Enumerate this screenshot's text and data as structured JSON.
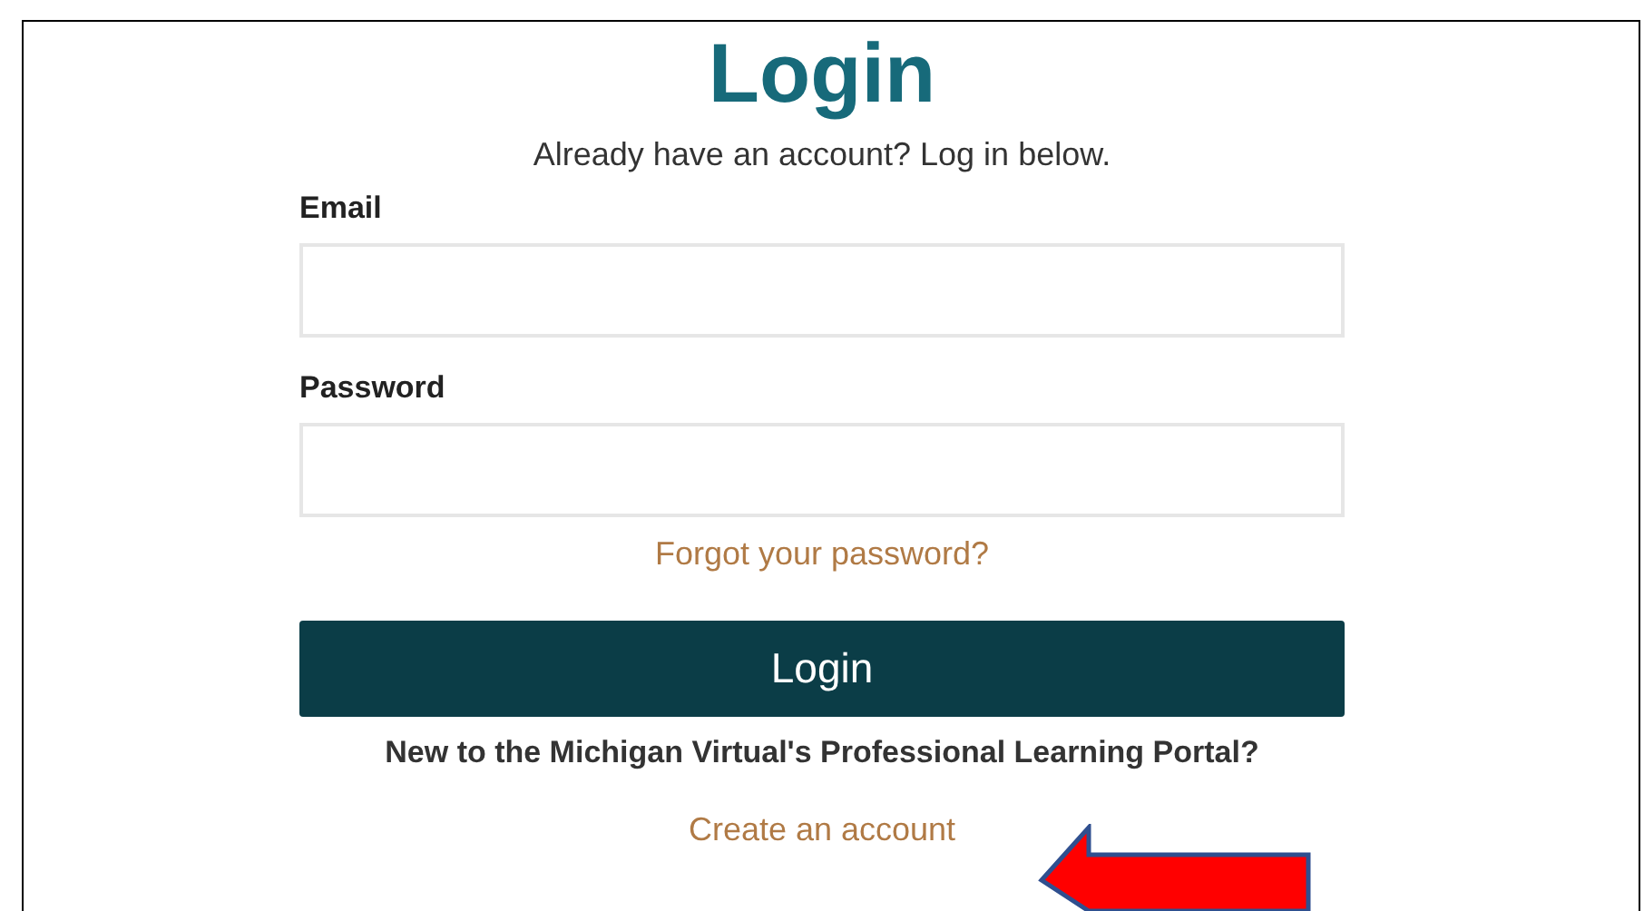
{
  "title": "Login",
  "subtitle": "Already have an account? Log in below.",
  "fields": [
    {
      "label": "Email"
    },
    {
      "label": "Password"
    }
  ],
  "forgot_link": "Forgot your password?",
  "login_button": "Login",
  "signup_prompt": "New to the Michigan Virtual's Professional Learning Portal?",
  "create_account_link": "Create an account",
  "annotation": {
    "kind": "arrow"
  }
}
